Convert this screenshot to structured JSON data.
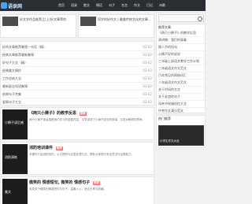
{
  "header": {
    "logo_text": "语录网",
    "nav": [
      "首页",
      "语录",
      "散文",
      "情话",
      "句子",
      "名言",
      "作文",
      "日记",
      "诗歌"
    ]
  },
  "hero": [
    {
      "title": "好文学作品推荐之(上)好文章等你"
    },
    {
      "title": "同学的好作文 | 最美传统文化的文章..."
    }
  ],
  "list": [
    {
      "title": "好的文章推荐集锦一句话（精）",
      "date": "03-02"
    },
    {
      "title": "经典文章推荐最新集锦",
      "date": "03-02"
    },
    {
      "title": "好句子大全（精）",
      "date": "03-02"
    },
    {
      "title": "经典美文摘抄",
      "date": "03-02"
    },
    {
      "title": "工作总结大全",
      "date": "03-02"
    },
    {
      "title": "最新励志短语集锦",
      "date": "03-02"
    },
    {
      "title": "经典句子合集",
      "date": "03-02"
    },
    {
      "title": "爱情句子大全",
      "date": "03-02"
    }
  ],
  "cards": [
    {
      "img_caption": "小狮子读后感",
      "title": "《两只小狮子》的教学反思",
      "tag": "最新",
      "desc": "两只小狮子读后感是我们学习的重要内容，文章讲述了小狮子成长的故事，引发对教育的思考。"
    },
    {
      "img_caption": "消防演练",
      "title": "消防培训课件",
      "tag": "推荐",
      "desc": "本课件介绍消防知识、火灾预防与应急处理方法，帮助大家提升安全意识与自救能力。"
    },
    {
      "img_caption": "美文",
      "title": "微笑的 情感短句, 微笑的 情感句子",
      "tag": "推荐",
      "desc": "收录关于微笑的情感短句与句子，温暖人心，适合分享与收藏。"
    }
  ],
  "right": {
    "search_placeholder": "",
    "section1_title": "推荐文章",
    "section1_items": [
      "《两只小狮子》的教学反思",
      "演讲稿：我们的青春",
      "情人节的短句",
      "心情不好的说说",
      "三年级上册语文教学工作计划",
      "三年级语文作文范文",
      "日本常见的网络词汇",
      "八年级语文作文范文",
      "关于时间的名言",
      "关于友谊的句子",
      "母亲节祝福短信大全",
      "中考作文满分范文"
    ],
    "section2_title": "热门推荐",
    "feature_title": "小学生作文大全"
  }
}
